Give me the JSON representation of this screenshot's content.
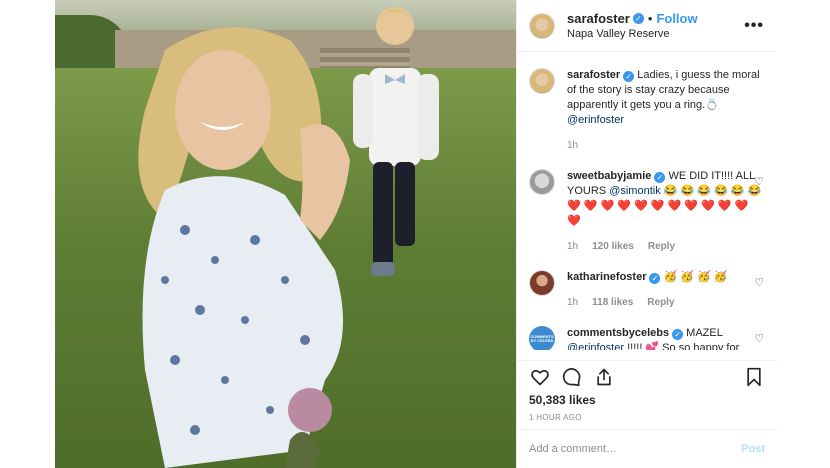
{
  "post": {
    "author": "sarafoster",
    "follow_label": "Follow",
    "location": "Napa Valley Reserve"
  },
  "caption": {
    "username": "sarafoster",
    "text": "Ladies, i guess the moral of the story is stay crazy because apparently it gets you a ring.💍",
    "mention": "@erinfoster",
    "time": "1h"
  },
  "comments": [
    {
      "username": "sweetbabyjamie",
      "text": "WE DID IT!!!! ALL YOURS",
      "mention": "@simontik",
      "emojis": "😂 😂 😂 😂 😂 😂 ❤️ ❤️ ❤️ ❤️ ❤️ ❤️ ❤️ ❤️ ❤️ ❤️ ❤️ ❤️",
      "time": "1h",
      "likes": "120 likes",
      "reply": "Reply"
    },
    {
      "username": "katharinefoster",
      "emojis": "🥳 🥳 🥳 🥳",
      "time": "1h",
      "likes": "118 likes",
      "reply": "Reply"
    },
    {
      "username": "commentsbycelebs",
      "text": "MAZEL",
      "mention": "@erinfoster",
      "tail": "!!!!! 💕   So so happy for"
    }
  ],
  "actions": {
    "likes": "50,383 likes",
    "time": "1 HOUR AGO"
  },
  "comment_box": {
    "placeholder": "Add a comment…",
    "post_label": "Post"
  },
  "icons": {
    "like": "heart-icon",
    "comment": "comment-icon",
    "share": "share-icon",
    "save": "bookmark-icon",
    "more": "more-options-icon"
  },
  "colors": {
    "link": "#3897f0",
    "mention": "#003569",
    "muted": "#8e8e8e"
  }
}
